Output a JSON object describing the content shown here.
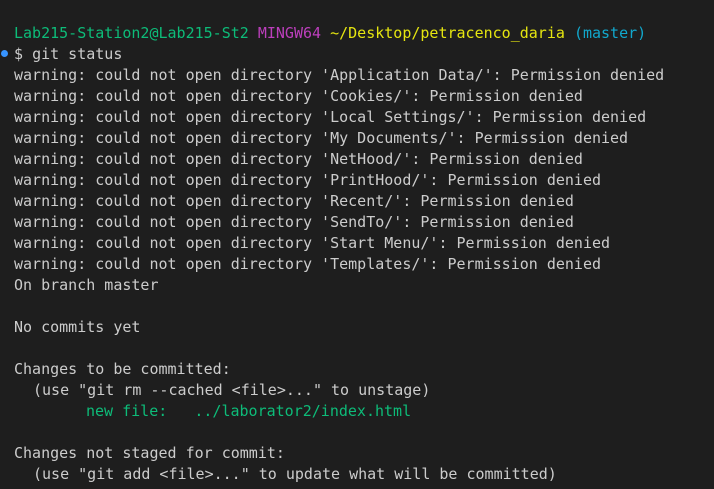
{
  "prompt": {
    "user_host": "Lab215-Station2@Lab215-St2",
    "shell": "MINGW64",
    "path": "~/Desktop/petracenco_daria",
    "branch": "(master)"
  },
  "command": {
    "symbol": "$",
    "text": "git status"
  },
  "warnings": [
    "warning: could not open directory 'Application Data/': Permission denied",
    "warning: could not open directory 'Cookies/': Permission denied",
    "warning: could not open directory 'Local Settings/': Permission denied",
    "warning: could not open directory 'My Documents/': Permission denied",
    "warning: could not open directory 'NetHood/': Permission denied",
    "warning: could not open directory 'PrintHood/': Permission denied",
    "warning: could not open directory 'Recent/': Permission denied",
    "warning: could not open directory 'SendTo/': Permission denied",
    "warning: could not open directory 'Start Menu/': Permission denied",
    "warning: could not open directory 'Templates/': Permission denied"
  ],
  "status": {
    "branch_line": "On branch master",
    "commits_line": "No commits yet",
    "to_be_committed_header": "Changes to be committed:",
    "to_be_committed_hint": "(use \"git rm --cached <file>...\" to unstage)",
    "staged_file": "new file:   ../laborator2/index.html",
    "not_staged_header": "Changes not staged for commit:",
    "not_staged_hint": "(use \"git add <file>...\" to update what will be committed)"
  },
  "colors": {
    "background": "#1e1e1e",
    "text": "#cccccc",
    "user_host": "#0dbc79",
    "shell": "#bc3fbc",
    "path": "#e5e510",
    "branch": "#11a8cd",
    "staged_file": "#0dbc79",
    "command_marker": "#3794ff"
  }
}
